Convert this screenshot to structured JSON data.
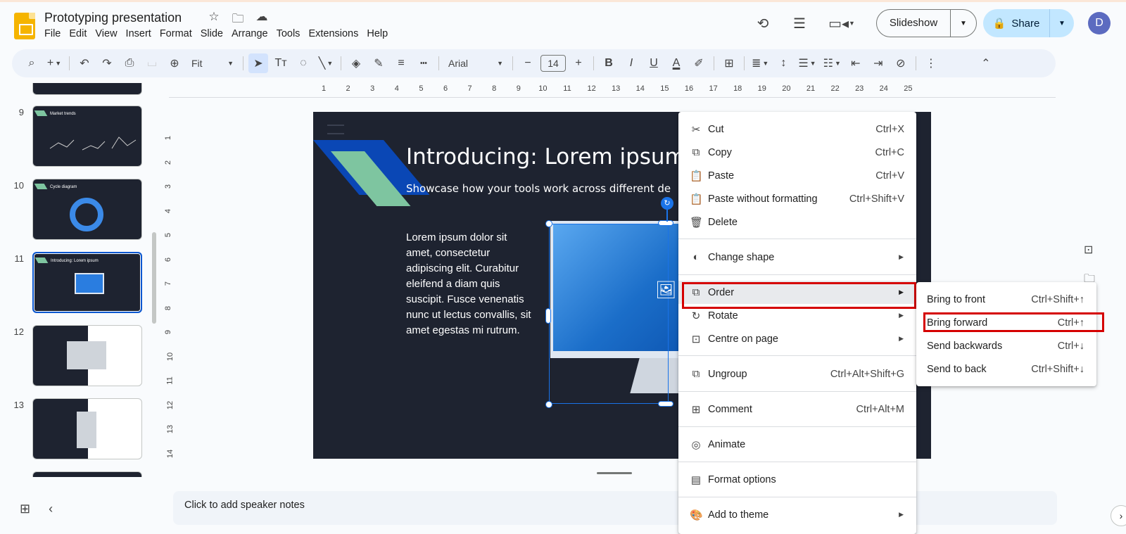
{
  "doc": {
    "title": "Prototyping presentation",
    "menus": [
      "File",
      "Edit",
      "View",
      "Insert",
      "Format",
      "Slide",
      "Arrange",
      "Tools",
      "Extensions",
      "Help"
    ]
  },
  "header": {
    "slideshow_label": "Slideshow",
    "share_label": "Share",
    "avatar_initial": "D"
  },
  "toolbar": {
    "zoom_label": "Fit",
    "font_label": "Arial",
    "font_size": "14"
  },
  "filmstrip": {
    "slides": [
      {
        "num": "9",
        "title": "Market trends"
      },
      {
        "num": "10",
        "title": "Cycle diagram"
      },
      {
        "num": "11",
        "title": "Introducing: Lorem ipsum"
      },
      {
        "num": "12",
        "title": ""
      },
      {
        "num": "13",
        "title": ""
      }
    ]
  },
  "rulers": {
    "top": [
      "1",
      "2",
      "3",
      "4",
      "5",
      "6",
      "7",
      "8",
      "9",
      "10",
      "11",
      "12",
      "13",
      "14",
      "15",
      "16",
      "17",
      "18",
      "19",
      "20",
      "21",
      "22",
      "23",
      "24",
      "25"
    ],
    "left": [
      "1",
      "2",
      "3",
      "4",
      "5",
      "6",
      "7",
      "8",
      "9",
      "10",
      "11",
      "12",
      "13",
      "14"
    ]
  },
  "slide": {
    "title": "Introducing: Lorem ipsum",
    "subtitle": "Showcase how your tools work across different de",
    "body": "Lorem ipsum dolor sit amet, consectetur adipiscing elit. Curabitur eleifend a diam quis suscipit. Fusce venenatis nunc ut lectus convallis, sit amet egestas mi rutrum."
  },
  "notes": {
    "placeholder": "Click to add speaker notes"
  },
  "context_menu": {
    "items": [
      {
        "label": "Cut",
        "shortcut": "Ctrl+X",
        "icon": "scissors-icon"
      },
      {
        "label": "Copy",
        "shortcut": "Ctrl+C",
        "icon": "copy-icon"
      },
      {
        "label": "Paste",
        "shortcut": "Ctrl+V",
        "icon": "paste-icon"
      },
      {
        "label": "Paste without formatting",
        "shortcut": "Ctrl+Shift+V",
        "icon": "paste-plain-icon"
      },
      {
        "label": "Delete",
        "shortcut": "",
        "icon": "trash-icon"
      },
      {
        "label": "Change shape",
        "shortcut": "",
        "icon": "shapes-icon"
      },
      {
        "label": "Order",
        "shortcut": "",
        "icon": "order-icon"
      },
      {
        "label": "Rotate",
        "shortcut": "",
        "icon": "rotate-icon"
      },
      {
        "label": "Centre on page",
        "shortcut": "",
        "icon": "center-icon"
      },
      {
        "label": "Ungroup",
        "shortcut": "Ctrl+Alt+Shift+G",
        "icon": "ungroup-icon"
      },
      {
        "label": "Comment",
        "shortcut": "Ctrl+Alt+M",
        "icon": "comment-icon"
      },
      {
        "label": "Animate",
        "shortcut": "",
        "icon": "animate-icon"
      },
      {
        "label": "Format options",
        "shortcut": "",
        "icon": "format-paint-icon"
      },
      {
        "label": "Add to theme",
        "shortcut": "",
        "icon": "palette-icon"
      }
    ]
  },
  "order_submenu": {
    "items": [
      {
        "label": "Bring to front",
        "shortcut": "Ctrl+Shift+↑"
      },
      {
        "label": "Bring forward",
        "shortcut": "Ctrl+↑"
      },
      {
        "label": "Send backwards",
        "shortcut": "Ctrl+↓"
      },
      {
        "label": "Send to back",
        "shortcut": "Ctrl+Shift+↓"
      }
    ]
  },
  "colors": {
    "accent": "#0b57d0",
    "highlight_box": "#d50000",
    "slide_bg": "#1e2330",
    "share_bg": "#c2e7ff"
  }
}
